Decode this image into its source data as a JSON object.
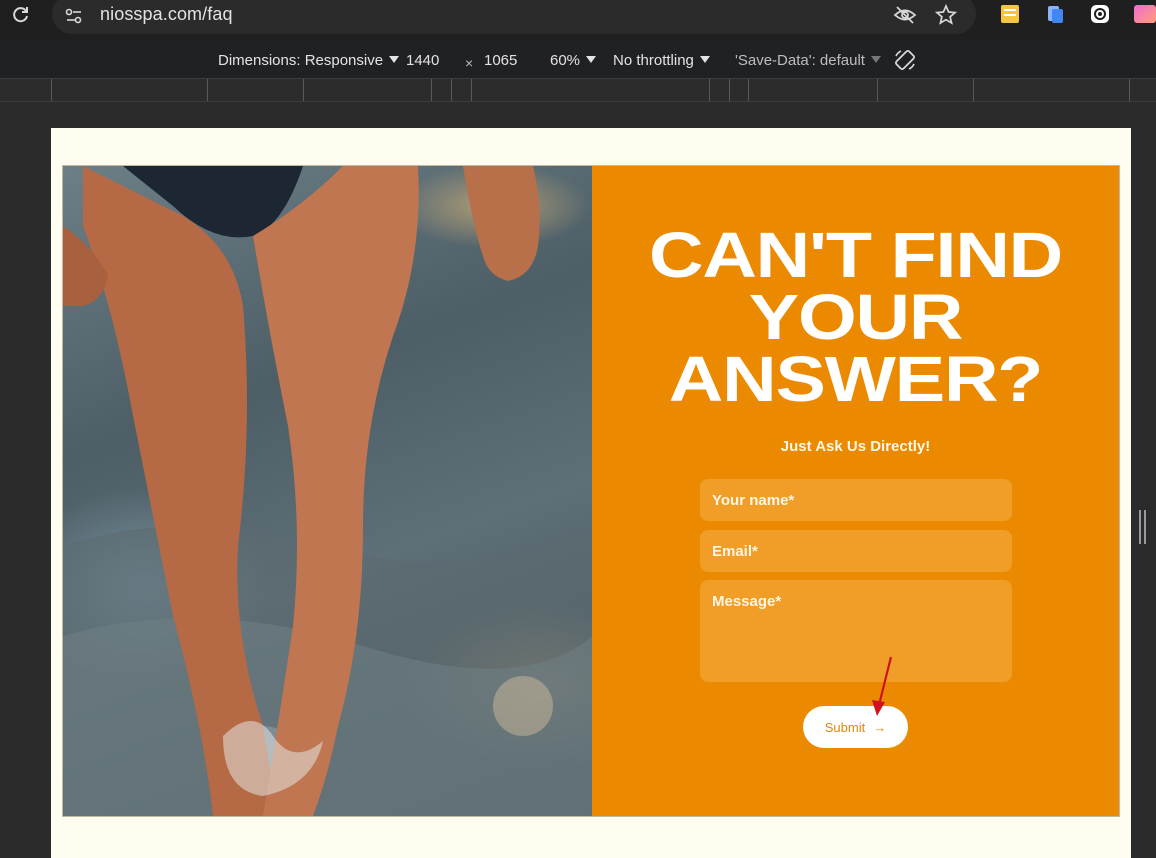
{
  "browser": {
    "url": "niosspa.com/faq"
  },
  "devtools": {
    "dimensions_label": "Dimensions: Responsive",
    "width": "1440",
    "times": "×",
    "height": "1065",
    "zoom": "60%",
    "throttling": "No throttling",
    "save_data": "'Save-Data': default"
  },
  "page": {
    "headline": [
      "CAN'T FIND",
      "YOUR",
      "ANSWER?"
    ],
    "subtitle": "Just Ask Us Directly!",
    "form": {
      "name_placeholder": "Your name*",
      "email_placeholder": "Email*",
      "message_placeholder": "Message*",
      "submit_label": "Submit",
      "submit_arrow": "→"
    }
  },
  "colors": {
    "accent_orange": "#eb8a00",
    "page_background": "#fffdf0",
    "annotation_arrow": "#d0121b"
  }
}
